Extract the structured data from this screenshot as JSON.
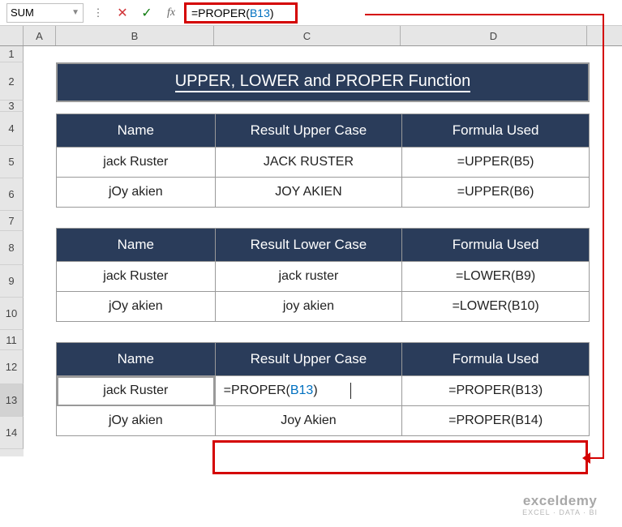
{
  "nameBox": "SUM",
  "formulaBar": {
    "prefix": "=PROPER(",
    "ref": "B13",
    "suffix": ")"
  },
  "columns": [
    "A",
    "B",
    "C",
    "D"
  ],
  "rows": [
    "1",
    "2",
    "3",
    "4",
    "5",
    "6",
    "7",
    "8",
    "9",
    "10",
    "11",
    "12",
    "13",
    "14"
  ],
  "title": "UPPER, LOWER and PROPER Function",
  "table1": {
    "headers": [
      "Name",
      "Result Upper Case",
      "Formula Used"
    ],
    "rows": [
      {
        "name": "jack Ruster",
        "result": "JACK RUSTER",
        "formula": "=UPPER(B5)"
      },
      {
        "name": "jOy akien",
        "result": "JOY AKIEN",
        "formula": "=UPPER(B6)"
      }
    ]
  },
  "table2": {
    "headers": [
      "Name",
      "Result Lower Case",
      "Formula Used"
    ],
    "rows": [
      {
        "name": "jack Ruster",
        "result": "jack ruster",
        "formula": "=LOWER(B9)"
      },
      {
        "name": "jOy akien",
        "result": "joy akien",
        "formula": "=LOWER(B10)"
      }
    ]
  },
  "table3": {
    "headers": [
      "Name",
      "Result Upper Case",
      "Formula Used"
    ],
    "rows": [
      {
        "name": "jack Ruster",
        "result_prefix": "=PROPER(",
        "result_ref": "B13",
        "result_suffix": ")",
        "formula": "=PROPER(B13)"
      },
      {
        "name": "jOy akien",
        "result": "Joy Akien",
        "formula": "=PROPER(B14)"
      }
    ]
  },
  "watermark": {
    "brand": "exceldemy",
    "sub": "EXCEL · DATA · BI"
  }
}
